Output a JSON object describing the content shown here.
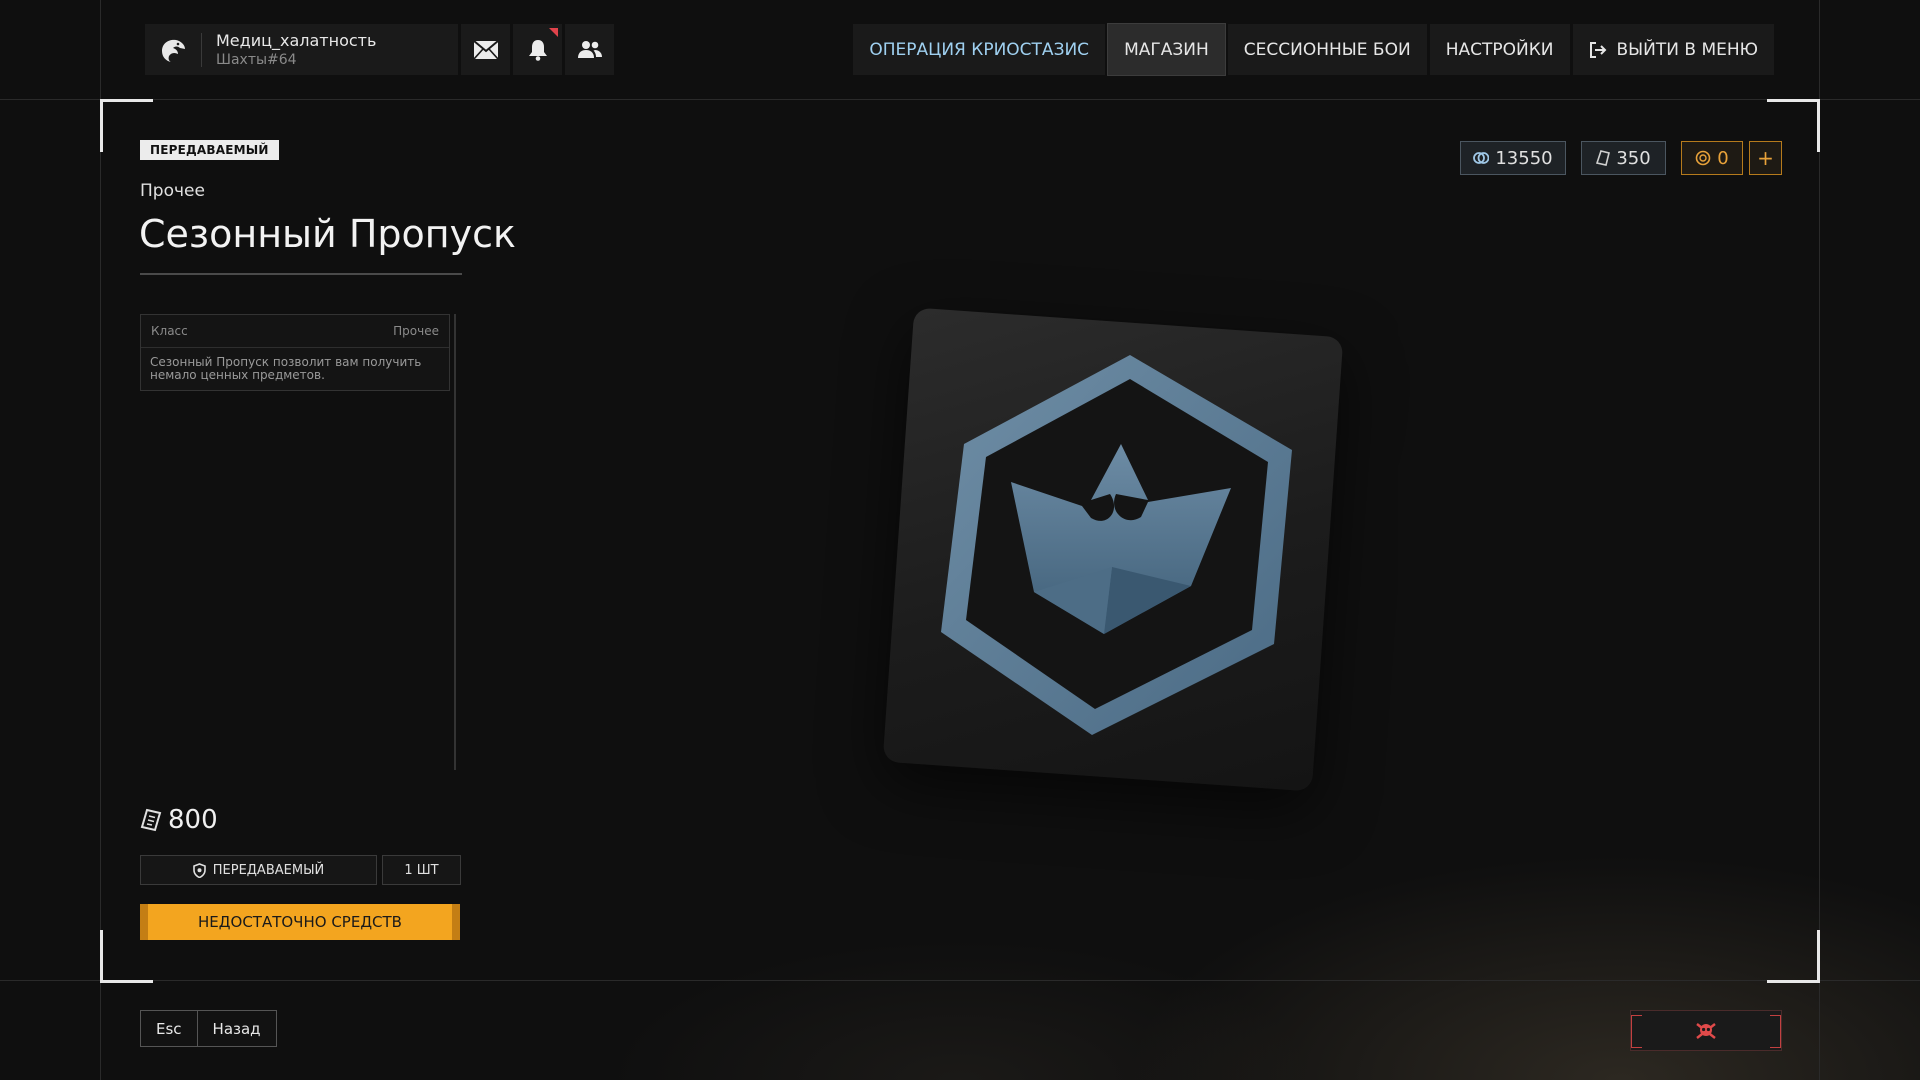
{
  "profile": {
    "nickname": "Медиц_халатность",
    "tag": "Шахты#64",
    "avatar_icon": "eagle-icon"
  },
  "top_icons": [
    "mail-icon",
    "bell-icon",
    "friends-icon"
  ],
  "nav": {
    "items": [
      {
        "label": "ОПЕРАЦИЯ КРИОСТАЗИС"
      },
      {
        "label": "МАГАЗИН"
      },
      {
        "label": "СЕССИОННЫЕ БОИ"
      },
      {
        "label": "НАСТРОЙКИ"
      },
      {
        "label": "ВЫЙТИ В МЕНЮ"
      }
    ],
    "active_index": 1
  },
  "item": {
    "badge": "ПЕРЕДАВАЕМЫЙ",
    "category": "Прочее",
    "title": "Сезонный Пропуск",
    "info": {
      "class_label": "Класс",
      "class_value": "Прочее",
      "description": "Сезонный Пропуск позволит вам получить немало ценных предметов."
    },
    "price": "800",
    "tradable_label": "ПЕРЕДАВАЕМЫЙ",
    "quantity": "1 ШТ",
    "buy_label": "НЕДОСТАТОЧНО СРЕДСТВ"
  },
  "currencies": {
    "credits": "13550",
    "tickets": "350",
    "gold": "0",
    "add_label": "+"
  },
  "bottom": {
    "key": "Esc",
    "back_label": "Назад"
  },
  "colors": {
    "accent_orange": "#f3a51f",
    "nav_accent": "#9fd0f0",
    "notif_red": "#e0434b",
    "emblem_blue": "#5e7f99"
  }
}
